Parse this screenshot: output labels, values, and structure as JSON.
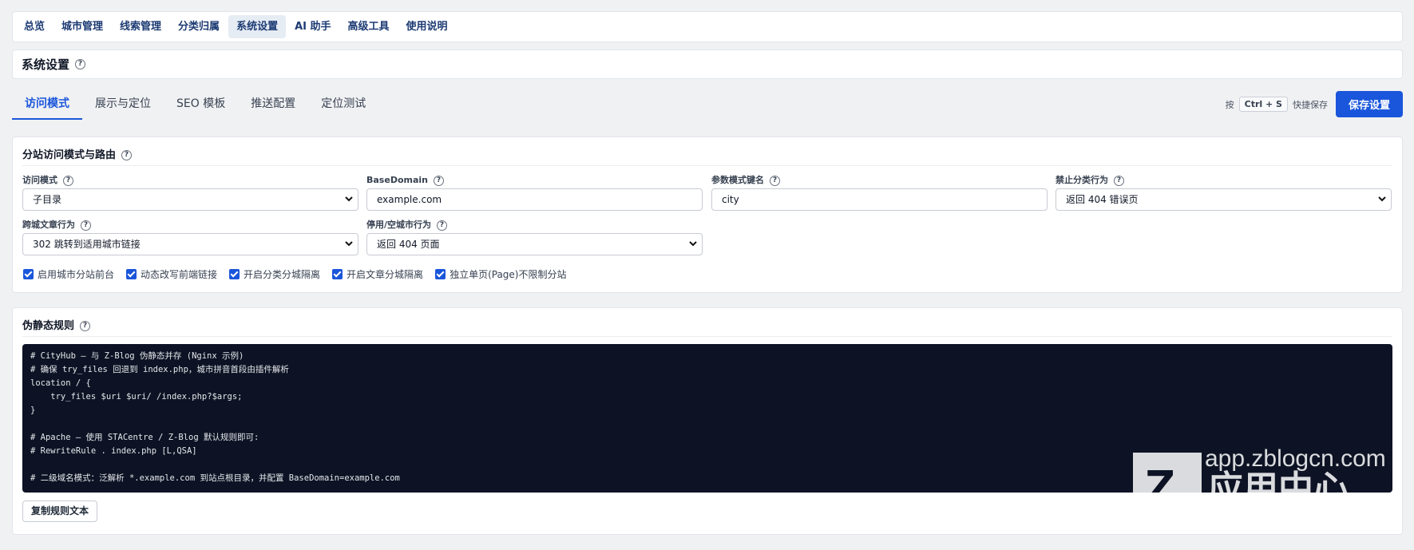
{
  "nav": {
    "items": [
      {
        "label": "总览",
        "active": false
      },
      {
        "label": "城市管理",
        "active": false
      },
      {
        "label": "线索管理",
        "active": false
      },
      {
        "label": "分类归属",
        "active": false
      },
      {
        "label": "系统设置",
        "active": true
      },
      {
        "label": "AI 助手",
        "active": false
      },
      {
        "label": "高级工具",
        "active": false
      },
      {
        "label": "使用说明",
        "active": false
      }
    ]
  },
  "page": {
    "title": "系统设置",
    "help": "?"
  },
  "tabs": [
    {
      "label": "访问模式",
      "active": true
    },
    {
      "label": "展示与定位",
      "active": false
    },
    {
      "label": "SEO 模板",
      "active": false
    },
    {
      "label": "推送配置",
      "active": false
    },
    {
      "label": "定位测试",
      "active": false
    }
  ],
  "save": {
    "prefix": "按",
    "shortcut": "Ctrl + S",
    "suffix": "快捷保存",
    "button": "保存设置"
  },
  "routing": {
    "title": "分站访问模式与路由",
    "help": "?",
    "fields": {
      "mode": {
        "label": "访问模式",
        "help": "?",
        "value": "子目录"
      },
      "basedomain": {
        "label": "BaseDomain",
        "help": "?",
        "value": "example.com"
      },
      "param": {
        "label": "参数模式键名",
        "help": "?",
        "value": "city"
      },
      "category": {
        "label": "禁止分类行为",
        "help": "?",
        "value": "返回 404 错误页"
      },
      "cross": {
        "label": "跨城文章行为",
        "help": "?",
        "value": "302 跳转到适用城市链接"
      },
      "disabled": {
        "label": "停用/空城市行为",
        "help": "?",
        "value": "返回 404 页面"
      }
    },
    "checkboxes": [
      {
        "label": "启用城市分站前台",
        "checked": true
      },
      {
        "label": "动态改写前端链接",
        "checked": true
      },
      {
        "label": "开启分类分城隔离",
        "checked": true
      },
      {
        "label": "开启文章分城隔离",
        "checked": true
      },
      {
        "label": "独立单页(Page)不限制分站",
        "checked": true
      }
    ]
  },
  "rewrite": {
    "title": "伪静态规则",
    "help": "?",
    "code": "# CityHub — 与 Z-Blog 伪静态并存 (Nginx 示例)\n# 确保 try_files 回退到 index.php，城市拼音首段由插件解析\nlocation / {\n    try_files $uri $uri/ /index.php?$args;\n}\n\n# Apache — 使用 STACentre / Z-Blog 默认规则即可:\n# RewriteRule . index.php [L,QSA]\n\n# 二级域名模式：泛解析 *.example.com 到站点根目录，并配置 BaseDomain=example.com",
    "copy_button": "复制规则文本",
    "watermark_line1": "app.zblogcn.com",
    "watermark_line2": "应用中心"
  },
  "colors": {
    "accent": "#1a56db",
    "nav_text": "#1d3b73",
    "code_bg": "#0d1324"
  }
}
